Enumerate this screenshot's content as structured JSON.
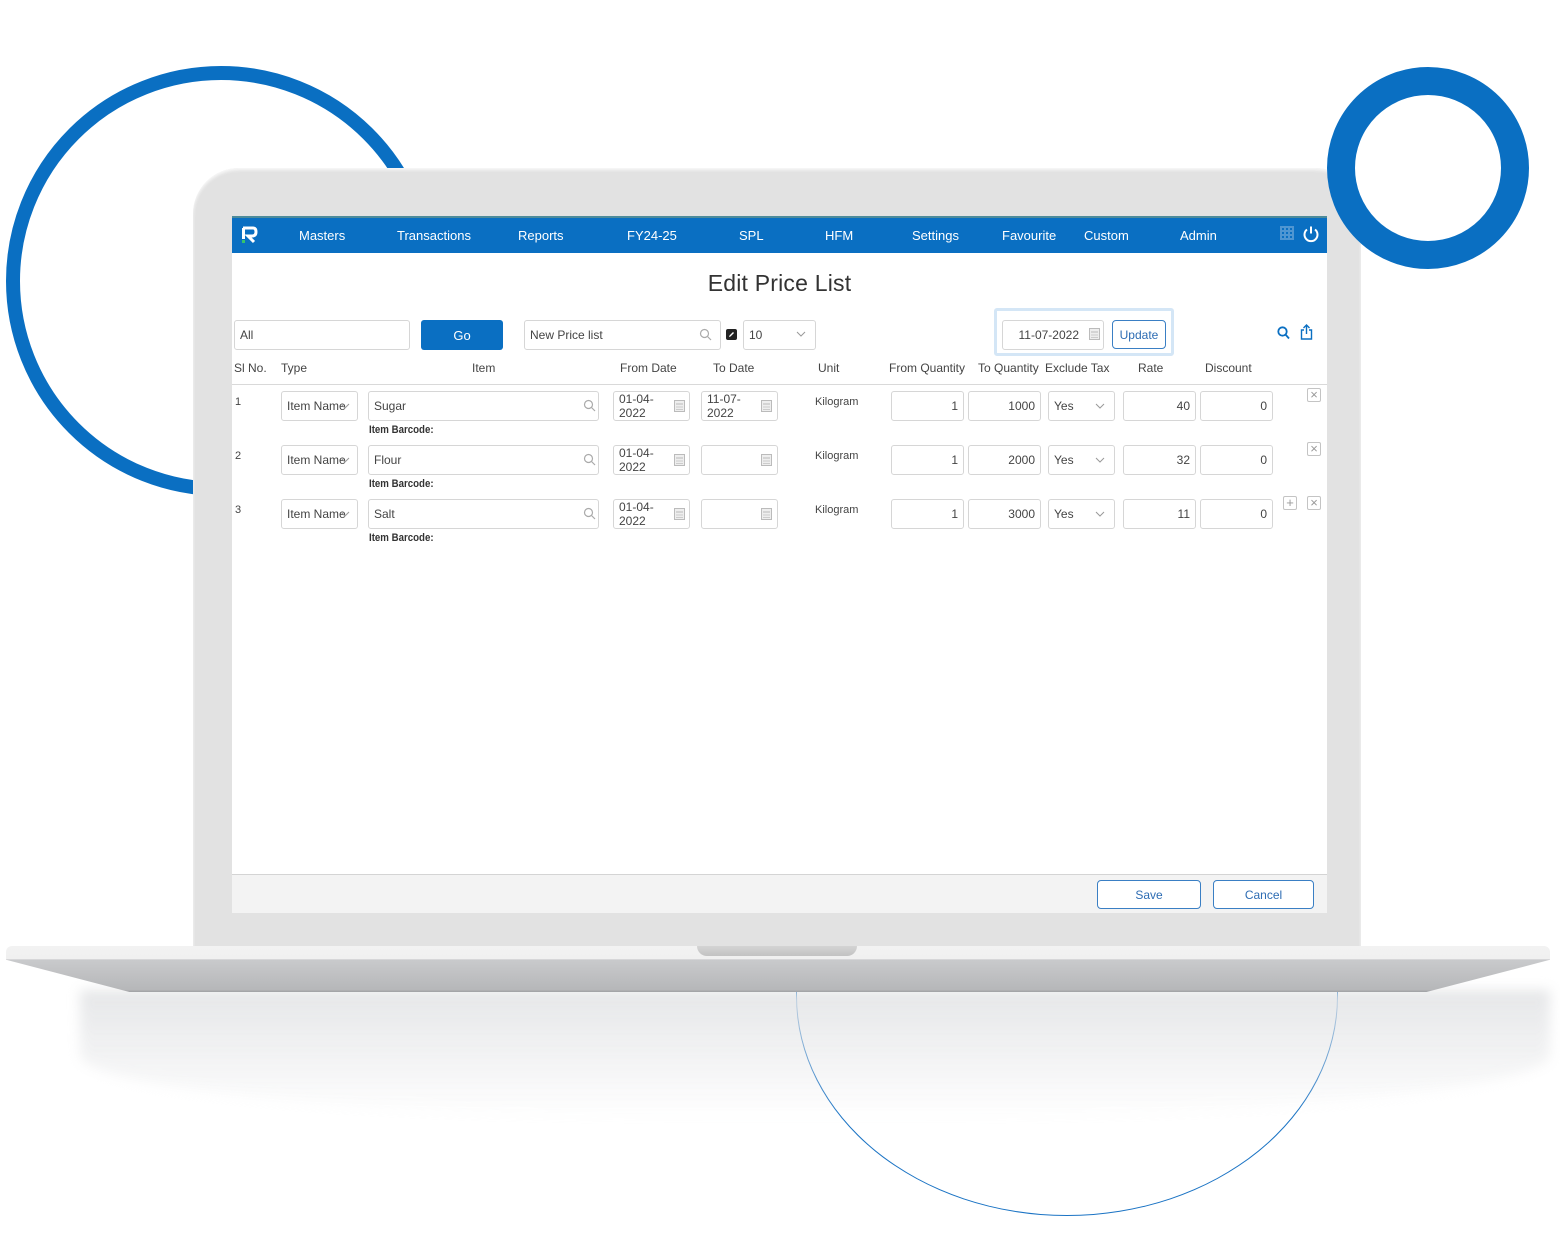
{
  "nav": {
    "items": [
      "Masters",
      "Transactions",
      "Reports",
      "FY24-25",
      "SPL",
      "HFM",
      "Settings",
      "Favourite",
      "Custom",
      "Admin"
    ],
    "icons": {
      "logo": "app-logo",
      "grid": "grid-icon",
      "power": "power-icon"
    }
  },
  "page": {
    "title": "Edit Price List"
  },
  "toolbar": {
    "filter_value": "All",
    "go_label": "Go",
    "price_list_value": "New Price list",
    "page_size_value": "10",
    "update_date": "11-07-2022",
    "update_label": "Update"
  },
  "table": {
    "headers": [
      "Sl No.",
      "Type",
      "Item",
      "From Date",
      "To Date",
      "Unit",
      "From Quantity",
      "To Quantity",
      "Exclude Tax",
      "Rate",
      "Discount"
    ],
    "barcode_label": "Item Barcode:",
    "rows": [
      {
        "sl": "1",
        "type": "Item Name",
        "item": "Sugar",
        "from_date": "01-04-2022",
        "to_date": "11-07-2022",
        "unit": "Kilogram",
        "from_qty": "1",
        "to_qty": "1000",
        "exclude_tax": "Yes",
        "rate": "40",
        "discount": "0"
      },
      {
        "sl": "2",
        "type": "Item Name",
        "item": "Flour",
        "from_date": "01-04-2022",
        "to_date": "",
        "unit": "Kilogram",
        "from_qty": "1",
        "to_qty": "2000",
        "exclude_tax": "Yes",
        "rate": "32",
        "discount": "0"
      },
      {
        "sl": "3",
        "type": "Item Name",
        "item": "Salt",
        "from_date": "01-04-2022",
        "to_date": "",
        "unit": "Kilogram",
        "from_qty": "1",
        "to_qty": "3000",
        "exclude_tax": "Yes",
        "rate": "11",
        "discount": "0"
      }
    ]
  },
  "footer": {
    "save_label": "Save",
    "cancel_label": "Cancel"
  },
  "colors": {
    "brand": "#0a6fc2",
    "outline_button": "#3a7fc4"
  }
}
